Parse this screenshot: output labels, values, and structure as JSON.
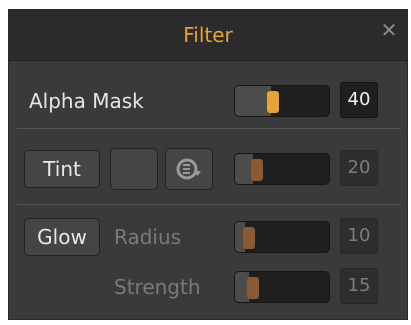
{
  "panel": {
    "title": "Filter",
    "close_icon": "close-icon"
  },
  "alpha_mask": {
    "label": "Alpha Mask",
    "slider_fraction": 0.4,
    "value": "40",
    "accent": "#e8a23a"
  },
  "tint": {
    "button_label": "Tint",
    "swatch_color": "#3a3a3a",
    "swap_icon": "cycle-arrow-icon",
    "slider_fraction": 0.2,
    "value": "20",
    "accent": "#8a5a35"
  },
  "glow": {
    "button_label": "Glow",
    "radius": {
      "label": "Radius",
      "slider_fraction": 0.1,
      "value": "10"
    },
    "strength": {
      "label": "Strength",
      "slider_fraction": 0.15,
      "value": "15"
    },
    "accent": "#8a5a35"
  }
}
